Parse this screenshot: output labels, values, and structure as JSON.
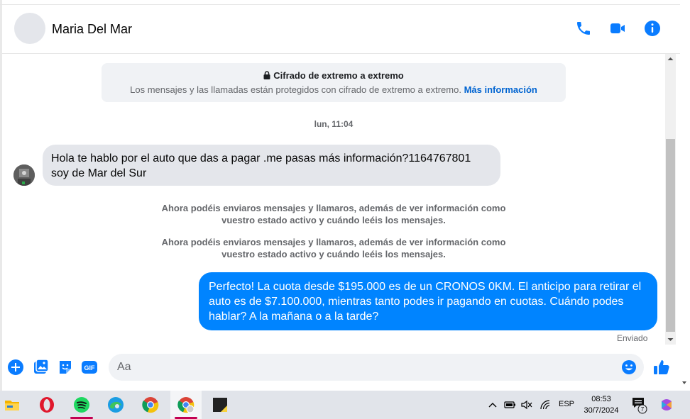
{
  "header": {
    "contact_name": "Maria Del Mar",
    "actions": [
      "phone-icon",
      "video-camera-icon",
      "info-icon"
    ]
  },
  "encryption": {
    "title": "Cifrado de extremo a extremo",
    "text": "Los mensajes y las llamadas están protegidos con cifrado de extremo a extremo.",
    "link": "Más información"
  },
  "conversation": {
    "timestamp": "lun, 11:04",
    "incoming_message": "Hola te hablo por el auto que das a pagar .me pasas más información?1164767801 soy de Mar del Sur",
    "system_notices": [
      "Ahora podéis enviaros mensajes y llamaros, además de ver información como vuestro estado activo y cuándo leéis los mensajes.",
      "Ahora podéis enviaros mensajes y llamaros, además de ver información como vuestro estado activo y cuándo leéis los mensajes."
    ],
    "outgoing_message": "Perfecto! La cuota desde $195.000 es de un CRONOS 0KM. El anticipo para retirar el auto es de $7.100.000, mientras tanto podes ir pagando en cuotas. Cuándo podes hablar? A la mañana o a la tarde?",
    "status": "Enviado"
  },
  "composer": {
    "placeholder": "Aa",
    "value": "",
    "gif_label": "GIF"
  },
  "taskbar": {
    "apps": [
      "file-explorer-icon",
      "opera-icon",
      "spotify-icon",
      "edge-icon",
      "chrome-icon",
      "chrome-profile-icon",
      "sticky-notes-icon"
    ],
    "language": "ESP",
    "time": "08:53",
    "date": "30/7/2024",
    "notification_count": "7"
  },
  "colors": {
    "accent": "#0084ff",
    "icon_blue": "#0a7cff",
    "incoming_bubble": "#e4e6eb"
  }
}
